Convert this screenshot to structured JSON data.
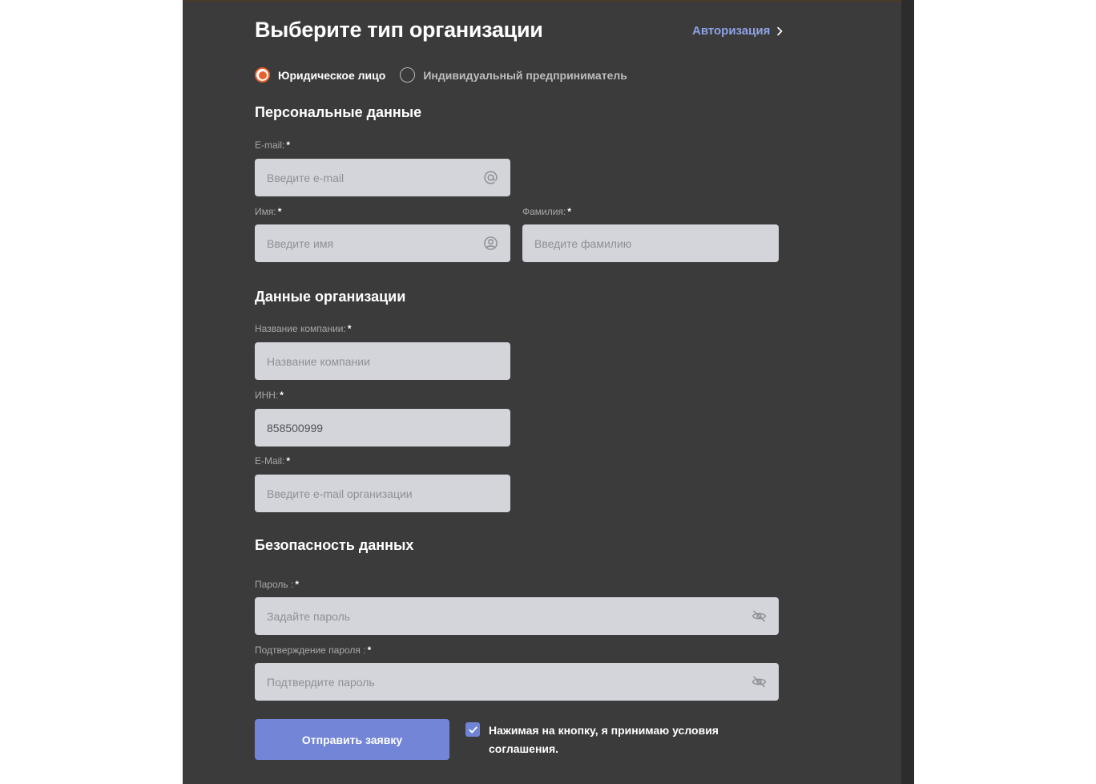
{
  "header": {
    "title": "Выберите тип организации",
    "auth_link": "Авторизация"
  },
  "org_type": {
    "options": [
      {
        "label": "Юридическое лицо",
        "selected": true
      },
      {
        "label": "Индивидуальный предприниматель",
        "selected": false
      }
    ]
  },
  "personal": {
    "heading": "Персональные данные",
    "email": {
      "label": "E-mail:",
      "required": "*",
      "placeholder": "Введите e-mail",
      "icon": "at-icon"
    },
    "first_name": {
      "label": "Имя:",
      "required": "*",
      "placeholder": "Введите имя",
      "icon": "user-icon"
    },
    "last_name": {
      "label": "Фамилия:",
      "required": "*",
      "placeholder": "Введите фамилию"
    }
  },
  "organization": {
    "heading": "Данные организации",
    "company": {
      "label": "Название компании:",
      "required": "*",
      "placeholder": "Название компании"
    },
    "inn": {
      "label": "ИНН:",
      "required": "*",
      "value": "858500999"
    },
    "email": {
      "label": "E-Mail:",
      "required": "*",
      "placeholder": "Введите e-mail организации"
    }
  },
  "security": {
    "heading": "Безопасность данных",
    "password": {
      "label": "Пароль :",
      "required": "*",
      "placeholder": "Задайте пароль",
      "icon": "eye-off-icon"
    },
    "confirm": {
      "label": "Подтверждение пароля :",
      "required": "*",
      "placeholder": "Подтвердите пароль",
      "icon": "eye-off-icon"
    }
  },
  "footer": {
    "submit_label": "Отправить заявку",
    "agree_checked": true,
    "agree_text": "Нажимая на кнопку, я принимаю условия соглашения."
  },
  "colors": {
    "panel_bg": "#3b3b3b",
    "field_bg": "#d3d5db",
    "accent_orange": "#e8612c",
    "accent_blue": "#7385d6",
    "link": "#8fa2e6"
  }
}
